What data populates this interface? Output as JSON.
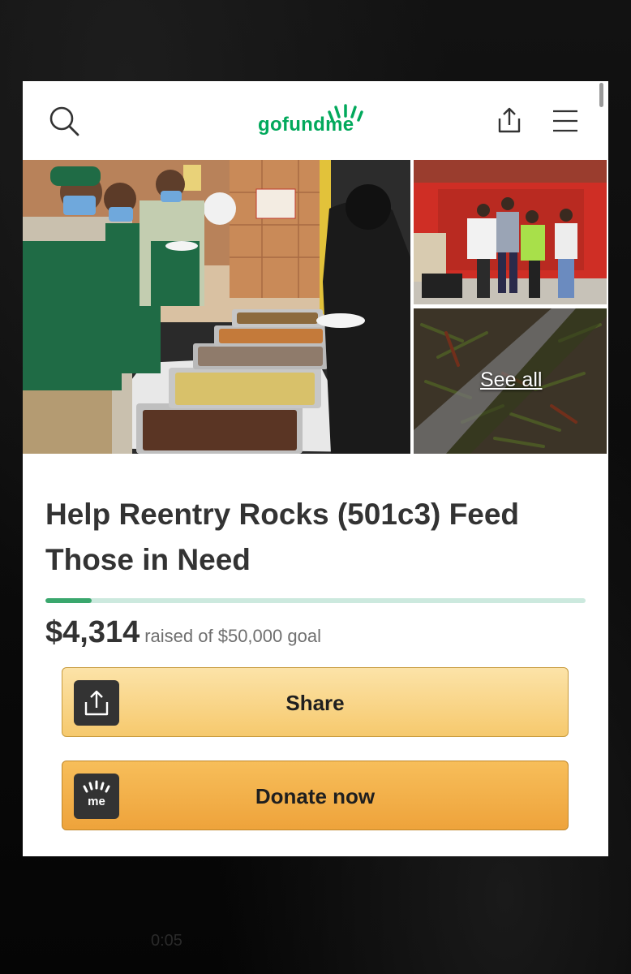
{
  "header": {
    "logo_text": "gofundme",
    "icons": [
      "search-icon",
      "share-upload-icon",
      "hamburger-menu-icon"
    ],
    "brand_color": "#02a95c"
  },
  "gallery": {
    "see_all_label": "See all"
  },
  "campaign": {
    "title": "Help Reentry Rocks (501c3) Feed Those in Need",
    "amount_raised": "$4,314",
    "goal_text": "raised of $50,000 goal",
    "progress_fraction": 0.086
  },
  "actions": {
    "share_label": "Share",
    "donate_label": "Donate now",
    "share_color": "#f6c96d",
    "donate_color": "#eea33b"
  },
  "background": {
    "timestamp": "0:05"
  }
}
